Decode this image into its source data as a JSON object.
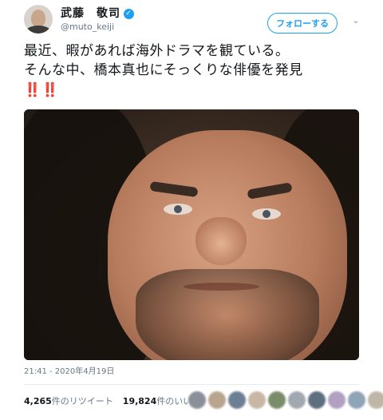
{
  "header": {
    "display_name": "武藤　敬司",
    "handle": "@muto_keiji",
    "follow_label": "フォローする",
    "verified_icon": "verified-check-icon",
    "chevron_icon": "chevron-down-icon"
  },
  "tweet": {
    "text": "最近、暇があれば海外ドラマを観ている。\nそんな中、橋本真也にそっくりな俳優を発見",
    "emoji": "‼️‼️",
    "timestamp": "21:41 - 2020年4月19日"
  },
  "stats": {
    "retweet_count": "4,265",
    "retweet_label": "件のリツイート",
    "like_count": "19,824",
    "like_label": "件のいいね"
  },
  "colors": {
    "accent": "#1da1f2",
    "secondary_text": "#657786",
    "emoji_red": "#e0245e"
  },
  "liker_avatars": [
    "#8a8f9a",
    "#b9a58f",
    "#6d7f92",
    "#c9b7a6",
    "#7b8c6a",
    "#a2a8b0",
    "#5e6f80",
    "#b1a0c2",
    "#8fa4b6",
    "#c0b6a8"
  ]
}
